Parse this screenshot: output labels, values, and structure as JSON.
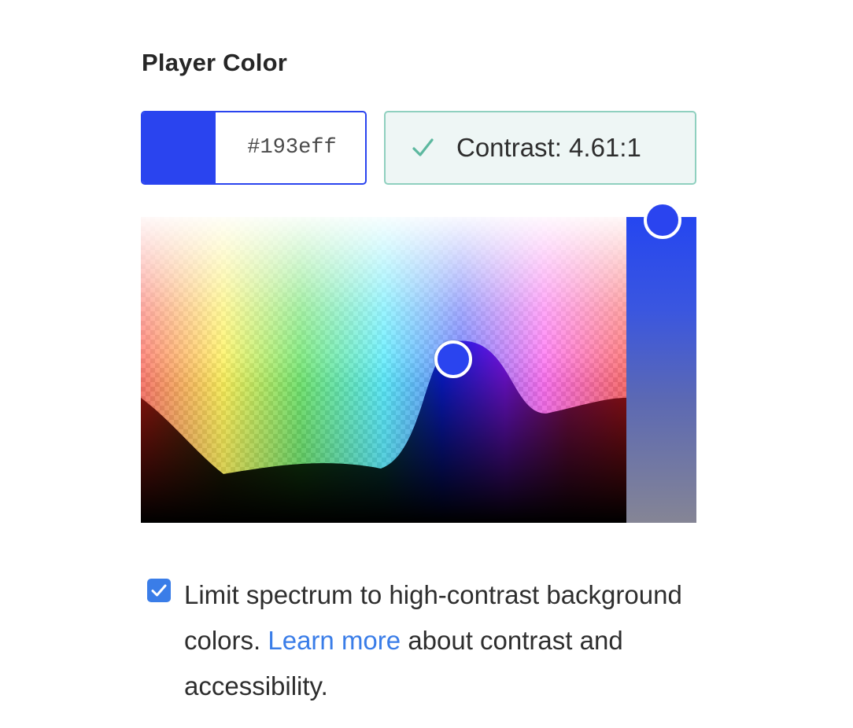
{
  "section": {
    "title": "Player Color"
  },
  "color_input": {
    "hex": "#193eff",
    "swatch_color": "#2a44ef"
  },
  "contrast": {
    "icon": "checkmark-icon",
    "label": "Contrast: 4.61:1",
    "border_color": "#8fd0bf",
    "background_color": "#eef6f5"
  },
  "spectrum": {
    "handle_color": "#2a44ef"
  },
  "lightness_slider": {
    "handle_color": "#2a44ef",
    "top_color": "#2546f0",
    "bottom_color": "#858595"
  },
  "limit_option": {
    "checked": true,
    "text_before": "Limit spectrum to high-contrast background colors.",
    "link_text": "Learn more",
    "text_after": "about contrast and accessibility.",
    "link_color": "#3a7de8"
  }
}
